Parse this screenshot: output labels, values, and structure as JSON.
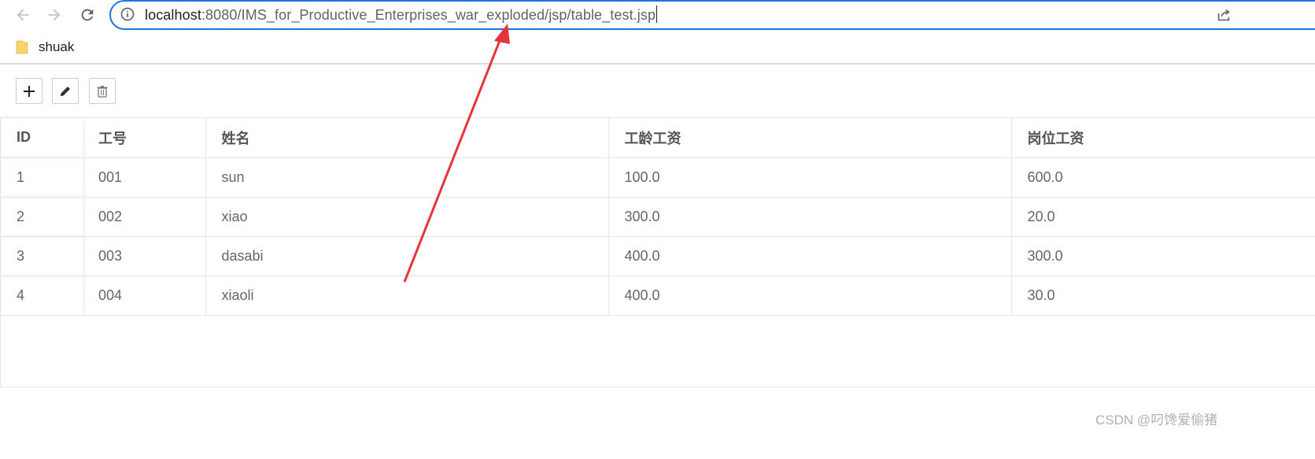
{
  "browser": {
    "url_host": "localhost",
    "url_rest": ":8080/IMS_for_Productive_Enterprises_war_exploded/jsp/table_test.jsp",
    "icons": {
      "back": "back-arrow-icon",
      "forward": "forward-arrow-icon",
      "reload": "reload-icon",
      "info": "info-icon",
      "share": "share-icon"
    }
  },
  "bookmarks": {
    "items": [
      {
        "label": "shuak",
        "icon": "folder-icon"
      }
    ]
  },
  "toolbar": {
    "buttons": [
      {
        "icon": "plus-icon"
      },
      {
        "icon": "pencil-icon"
      },
      {
        "icon": "trash-icon"
      }
    ]
  },
  "table": {
    "columns": [
      "ID",
      "工号",
      "姓名",
      "工龄工资",
      "岗位工资"
    ],
    "rows": [
      [
        "1",
        "001",
        "sun",
        "100.0",
        "600.0"
      ],
      [
        "2",
        "002",
        "xiao",
        "300.0",
        "20.0"
      ],
      [
        "3",
        "003",
        "dasabi",
        "400.0",
        "300.0"
      ],
      [
        "4",
        "004",
        "xiaoli",
        "400.0",
        "30.0"
      ]
    ]
  },
  "annotation": {
    "arrow_color": "#e8333a"
  },
  "watermark": "CSDN @叼馋爱偷猪",
  "colors": {
    "accent": "#1a73e8",
    "folder": "#f7d36b"
  }
}
